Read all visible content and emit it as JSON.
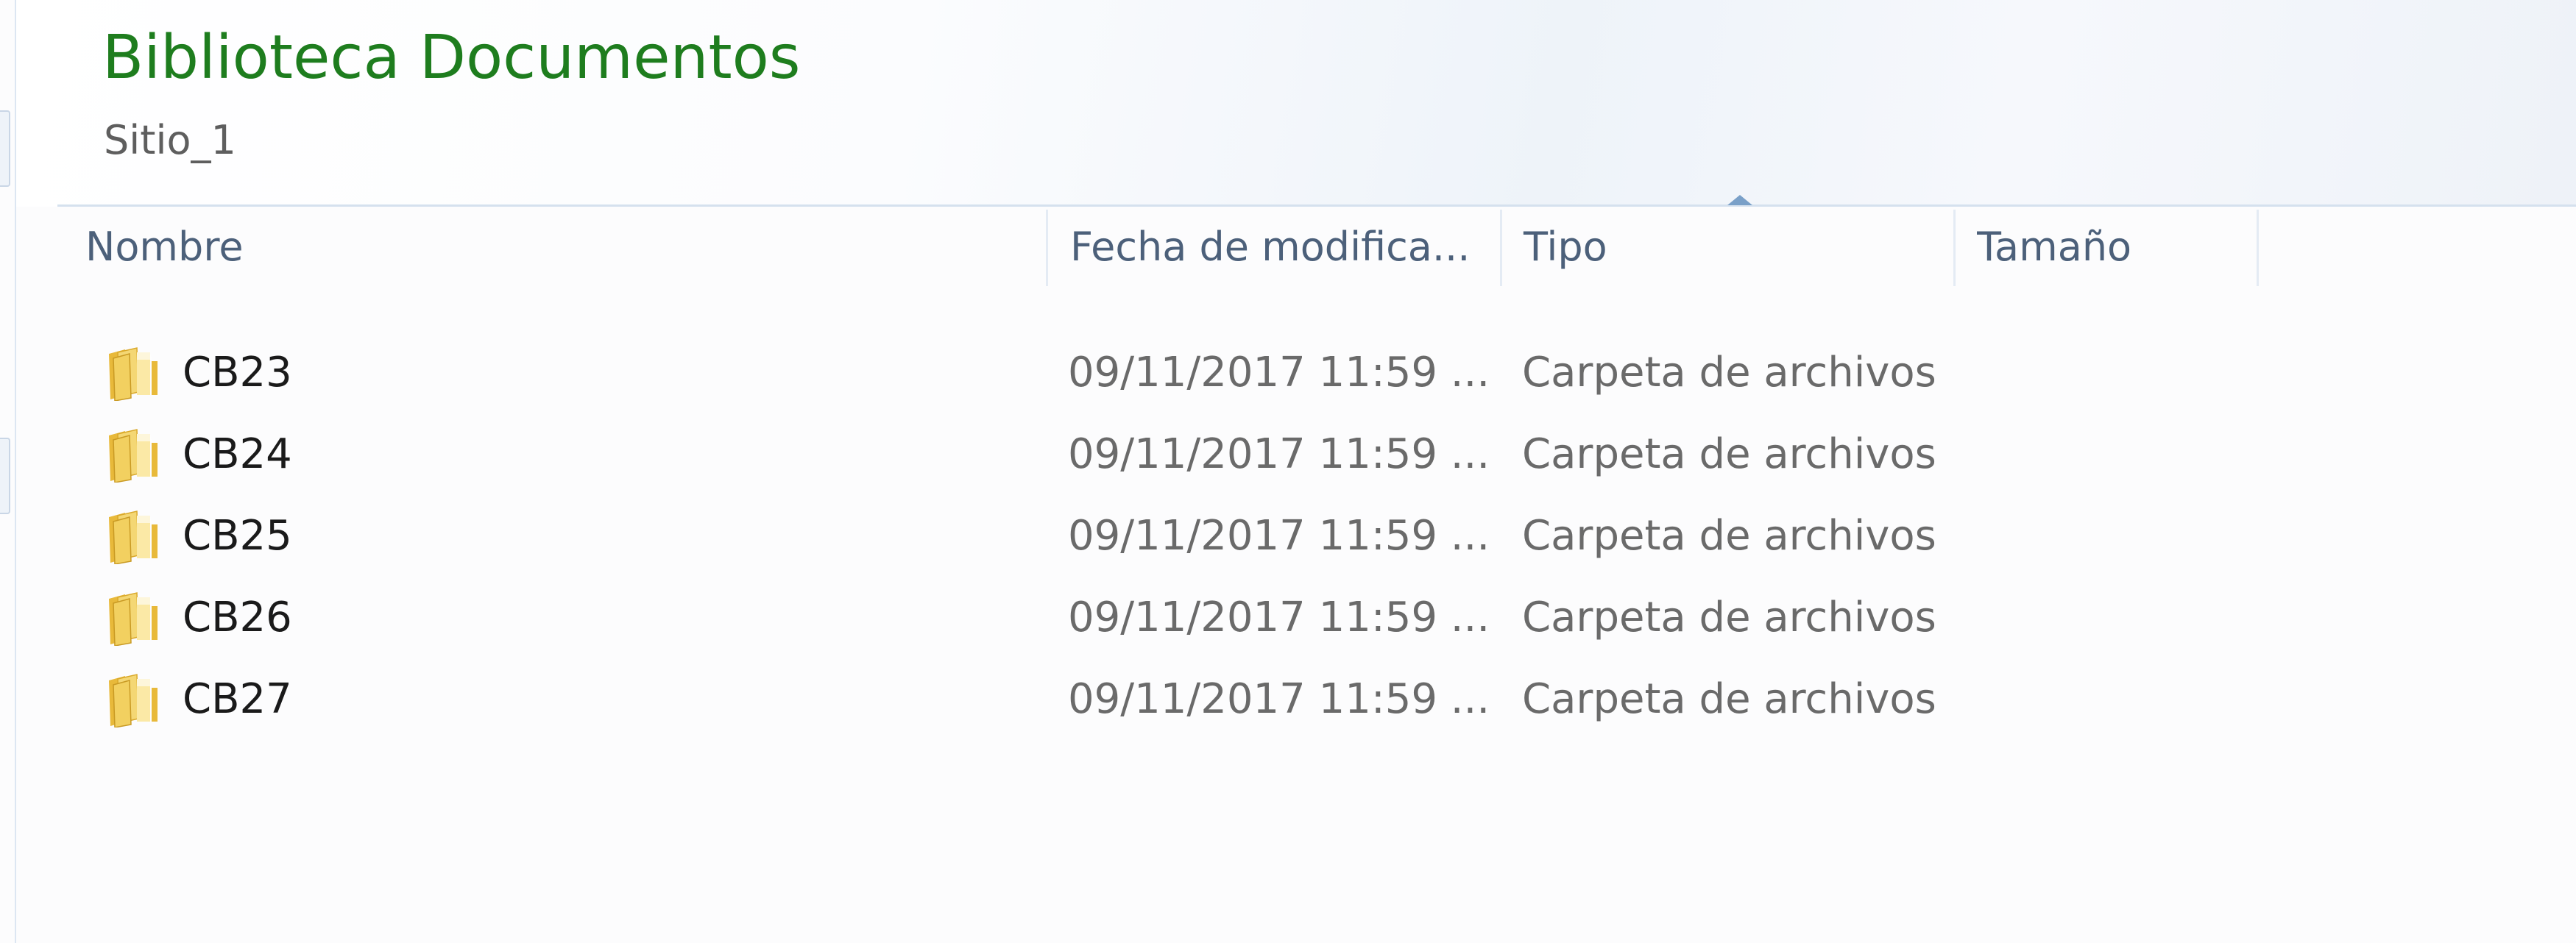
{
  "library": {
    "title": "Biblioteca Documentos",
    "subtitle": "Sitio_1"
  },
  "columns": {
    "name": "Nombre",
    "date": "Fecha de modifica...",
    "type": "Tipo",
    "size": "Tamaño",
    "sorted_by": "Tipo"
  },
  "rows": [
    {
      "name": "CB23",
      "date": "09/11/2017 11:59 ...",
      "type": "Carpeta de archivos",
      "size": "",
      "icon": "folder-icon"
    },
    {
      "name": "CB24",
      "date": "09/11/2017 11:59 ...",
      "type": "Carpeta de archivos",
      "size": "",
      "icon": "folder-icon"
    },
    {
      "name": "CB25",
      "date": "09/11/2017 11:59 ...",
      "type": "Carpeta de archivos",
      "size": "",
      "icon": "folder-icon"
    },
    {
      "name": "CB26",
      "date": "09/11/2017 11:59 ...",
      "type": "Carpeta de archivos",
      "size": "",
      "icon": "folder-icon"
    },
    {
      "name": "CB27",
      "date": "09/11/2017 11:59 ...",
      "type": "Carpeta de archivos",
      "size": "",
      "icon": "folder-icon"
    }
  ],
  "colors": {
    "title": "#1e7d1e",
    "header_text": "#4c607a",
    "folder_yellow": "#f2d060"
  }
}
